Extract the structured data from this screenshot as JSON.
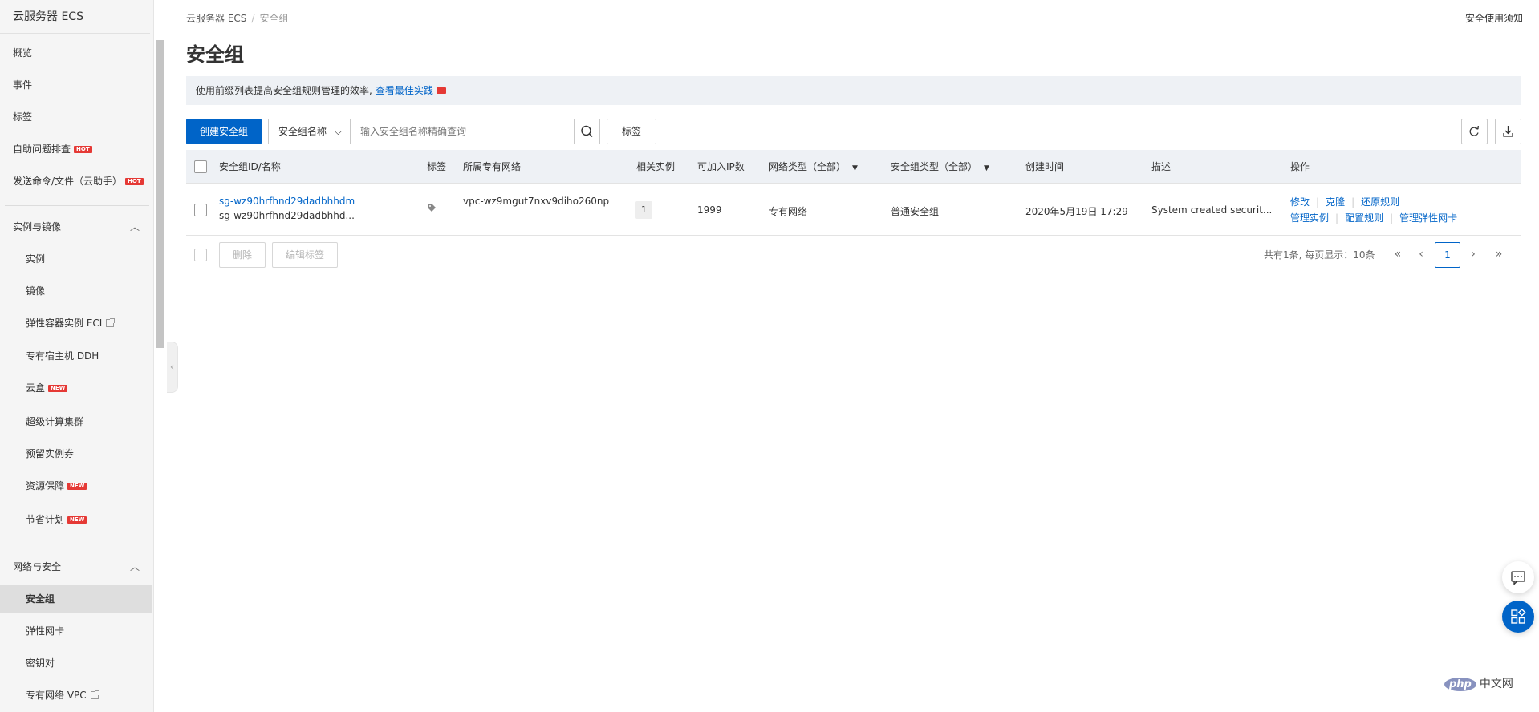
{
  "sidebar": {
    "title": "云服务器 ECS",
    "top_items": [
      {
        "label": "概览"
      },
      {
        "label": "事件"
      },
      {
        "label": "标签"
      },
      {
        "label": "自助问题排查",
        "badge": "HOT"
      },
      {
        "label": "发送命令/文件（云助手）",
        "badge": "HOT"
      }
    ],
    "section_instances": {
      "label": "实例与镜像",
      "items": [
        {
          "label": "实例"
        },
        {
          "label": "镜像"
        },
        {
          "label": "弹性容器实例 ECI"
        },
        {
          "label": "专有宿主机 DDH"
        },
        {
          "label": "云盒",
          "badge": "NEW"
        },
        {
          "label": "超级计算集群"
        },
        {
          "label": "预留实例券"
        },
        {
          "label": "资源保障",
          "badge": "NEW"
        },
        {
          "label": "节省计划",
          "badge": "NEW"
        }
      ]
    },
    "section_network": {
      "label": "网络与安全",
      "items": [
        {
          "label": "安全组"
        },
        {
          "label": "弹性网卡"
        },
        {
          "label": "密钥对"
        },
        {
          "label": "专有网络 VPC"
        }
      ]
    }
  },
  "header": {
    "breadcrumb_root": "云服务器 ECS",
    "breadcrumb_sep": "/",
    "breadcrumb_current": "安全组",
    "top_right_link": "安全使用须知",
    "title": "安全组"
  },
  "notice": {
    "text": "使用前缀列表提高安全组规则管理的效率,",
    "link": "查看最佳实践"
  },
  "toolbar": {
    "create_label": "创建安全组",
    "filter_select": "安全组名称",
    "search_placeholder": "输入安全组名称精确查询",
    "tag_label": "标签"
  },
  "table": {
    "headers": {
      "id_name": "安全组ID/名称",
      "tag": "标签",
      "vpc": "所属专有网络",
      "instances": "相关实例",
      "ip_count": "可加入IP数",
      "network_type": "网络类型（全部）",
      "sg_type": "安全组类型（全部）",
      "created": "创建时间",
      "desc": "描述",
      "ops": "操作"
    },
    "rows": [
      {
        "id": "sg-wz90hrfhnd29dadbhhdm",
        "name": "sg-wz90hrfhnd29dadbhhd...",
        "vpc": "vpc-wz9mgut7nxv9diho260np",
        "instances": "1",
        "ip_count": "1999",
        "network_type": "专有网络",
        "sg_type": "普通安全组",
        "created": "2020年5月19日 17:29",
        "desc": "System created securit...",
        "ops": {
          "modify": "修改",
          "clone": "克隆",
          "restore": "还原规则",
          "manage_instances": "管理实例",
          "config_rules": "配置规则",
          "manage_eni": "管理弹性网卡"
        }
      }
    ]
  },
  "footer": {
    "delete_label": "删除",
    "edit_tag_label": "编辑标签",
    "pager_info": "共有1条, 每页显示：10条",
    "current_page": "1"
  },
  "watermark": {
    "logo": "php",
    "text": "中文网"
  }
}
